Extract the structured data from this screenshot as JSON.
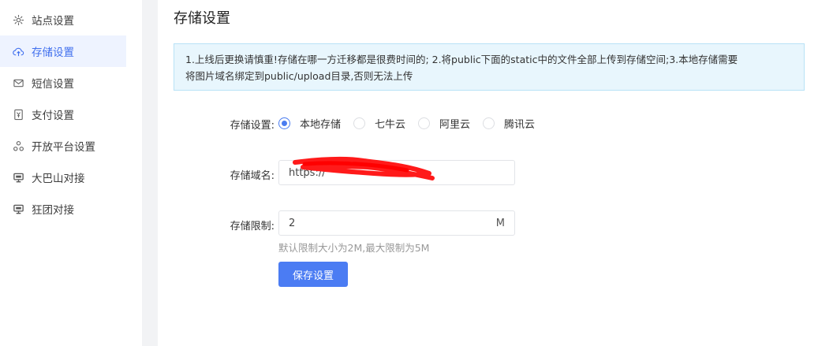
{
  "sidebar": {
    "items": [
      {
        "label": "站点设置",
        "icon": "gear-icon"
      },
      {
        "label": "存储设置",
        "icon": "cloud-upload-icon",
        "active": true
      },
      {
        "label": "短信设置",
        "icon": "mail-icon"
      },
      {
        "label": "支付设置",
        "icon": "yen-wallet-icon"
      },
      {
        "label": "开放平台设置",
        "icon": "nodes-icon"
      },
      {
        "label": "大巴山对接",
        "icon": "monitor-icon"
      },
      {
        "label": "狂团对接",
        "icon": "monitor-icon"
      }
    ]
  },
  "main": {
    "title": "存储设置",
    "notice": {
      "line1": "1.上线后更换请慎重!存储在哪一方迁移都是很费时间的; 2.将public下面的static中的文件全部上传到存储空间;3.本地存储需要",
      "line2": "将图片域名绑定到public/upload目录,否则无法上传"
    },
    "form": {
      "storage_label": "存储设置:",
      "storage_options": [
        {
          "label": "本地存储",
          "checked": true
        },
        {
          "label": "七牛云",
          "checked": false
        },
        {
          "label": "阿里云",
          "checked": false
        },
        {
          "label": "腾讯云",
          "checked": false
        }
      ],
      "domain_label": "存储域名:",
      "domain_value": "https://",
      "limit_label": "存储限制:",
      "limit_value": "2",
      "limit_unit": "M",
      "limit_hint": "默认限制大小为2M,最大限制为5M",
      "save_label": "保存设置"
    }
  },
  "colors": {
    "accent": "#4b7cf3",
    "active_bg": "#eef3ff",
    "notice_bg": "#e8f6fd",
    "notice_border": "#b8e2f6",
    "redaction": "#ff0000"
  }
}
